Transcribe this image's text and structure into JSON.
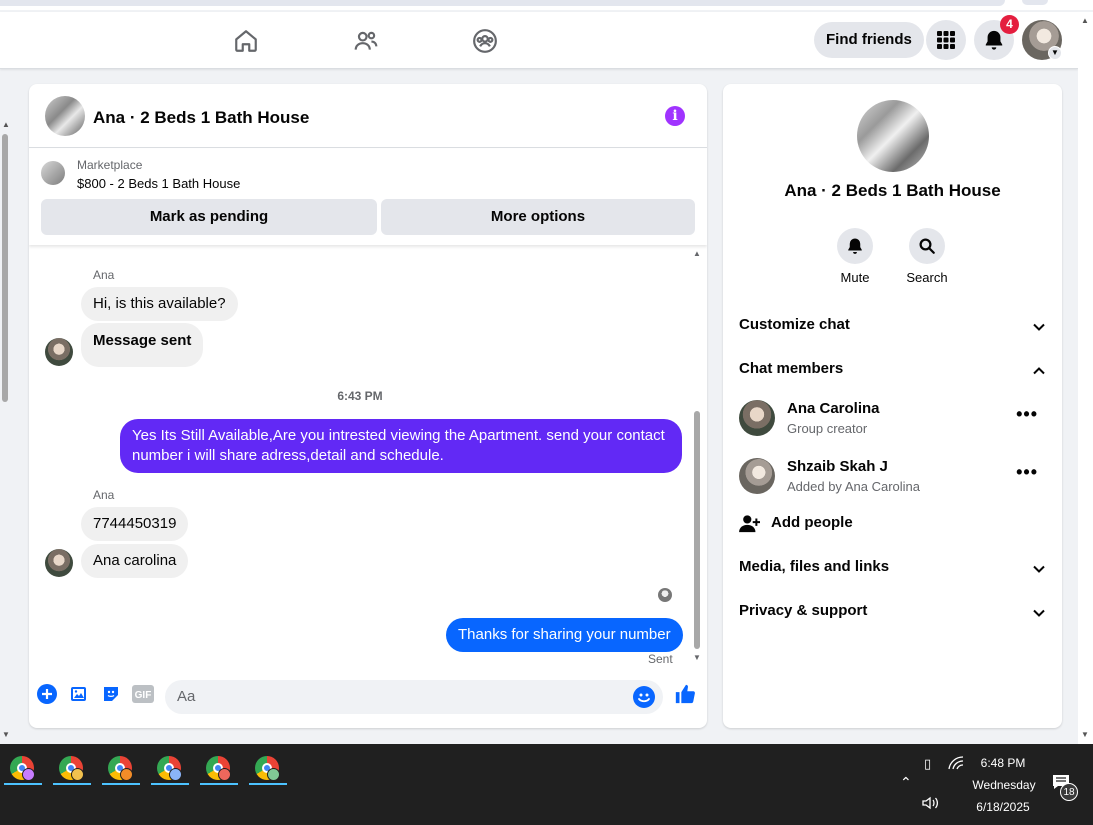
{
  "header": {
    "find_friends": "Find friends",
    "notification_count": "4",
    "nav_icons": [
      "home-icon",
      "friends-icon",
      "groups-icon"
    ]
  },
  "chat": {
    "title": "Ana · 2 Beds 1 Bath House",
    "marketplace": {
      "label": "Marketplace",
      "listing": "$800 - 2 Beds 1 Bath House",
      "mark_pending": "Mark as pending",
      "more_options": "More options"
    },
    "messages": [
      {
        "sender": "Ana",
        "text": "Hi, is this available?",
        "direction": "in"
      },
      {
        "text": "Message sent",
        "direction": "in"
      },
      {
        "timestamp": "6:43 PM"
      },
      {
        "text": "Yes Its Still Available,Are you intrested viewing the Apartment. send your contact number i will share adress,detail and schedule.",
        "direction": "out",
        "color": "#6229f5"
      },
      {
        "sender": "Ana",
        "text": "7744450319",
        "direction": "in"
      },
      {
        "text": "Ana carolina",
        "direction": "in"
      },
      {
        "text": "Thanks for sharing your number",
        "direction": "out",
        "color": "#0866ff"
      }
    ],
    "sent_status": "Sent",
    "composer": {
      "placeholder": "Aa",
      "gif_label": "GIF"
    }
  },
  "info_panel": {
    "name": "Ana · 2 Beds 1 Bath House",
    "actions": [
      {
        "label": "Mute",
        "icon": "bell-icon"
      },
      {
        "label": "Search",
        "icon": "search-icon"
      }
    ],
    "sections": {
      "customize": "Customize chat",
      "members": "Chat members",
      "media": "Media, files and links",
      "privacy": "Privacy & support"
    },
    "members": [
      {
        "name": "Ana Carolina",
        "role": "Group creator"
      },
      {
        "name": "Shzaib Skah J",
        "role": "Added by Ana Carolina"
      }
    ],
    "add_people": "Add people"
  },
  "taskbar": {
    "time": "6:48 PM",
    "day": "Wednesday",
    "date": "6/18/2025",
    "notifications": "18",
    "chrome_profiles": 6
  },
  "colors": {
    "accent": "#0866ff",
    "purple_bubble": "#6229f5",
    "info_icon": "#a033ff",
    "badge": "#e41e3f"
  }
}
